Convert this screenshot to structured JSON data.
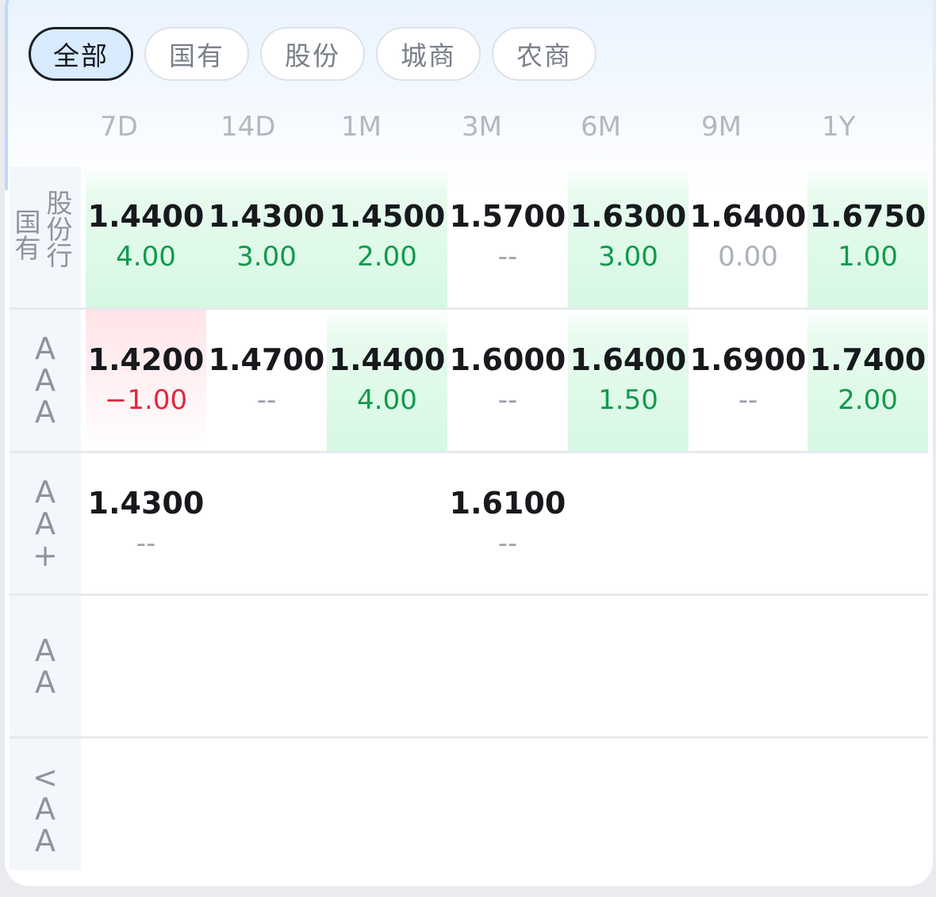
{
  "tabs": [
    {
      "label": "全部",
      "active": true
    },
    {
      "label": "国有",
      "active": false
    },
    {
      "label": "股份",
      "active": false
    },
    {
      "label": "城商",
      "active": false
    },
    {
      "label": "农商",
      "active": false
    }
  ],
  "columns": [
    "7D",
    "14D",
    "1M",
    "3M",
    "6M",
    "9M",
    "1Y"
  ],
  "rows": [
    {
      "label_left": "国有",
      "label_right": "股份行",
      "cells": [
        {
          "rate": "1.4400",
          "change": "4.00",
          "trend": "up"
        },
        {
          "rate": "1.4300",
          "change": "3.00",
          "trend": "up"
        },
        {
          "rate": "1.4500",
          "change": "2.00",
          "trend": "up"
        },
        {
          "rate": "1.5700",
          "change": "--",
          "trend": "none"
        },
        {
          "rate": "1.6300",
          "change": "3.00",
          "trend": "up"
        },
        {
          "rate": "1.6400",
          "change": "0.00",
          "trend": "zero"
        },
        {
          "rate": "1.6750",
          "change": "1.00",
          "trend": "up"
        }
      ]
    },
    {
      "label": "AAA",
      "cells": [
        {
          "rate": "1.4200",
          "change": "−1.00",
          "trend": "down"
        },
        {
          "rate": "1.4700",
          "change": "--",
          "trend": "none"
        },
        {
          "rate": "1.4400",
          "change": "4.00",
          "trend": "up"
        },
        {
          "rate": "1.6000",
          "change": "--",
          "trend": "none"
        },
        {
          "rate": "1.6400",
          "change": "1.50",
          "trend": "up"
        },
        {
          "rate": "1.6900",
          "change": "--",
          "trend": "none"
        },
        {
          "rate": "1.7400",
          "change": "2.00",
          "trend": "up"
        }
      ]
    },
    {
      "label": "AA+",
      "cells": [
        {
          "rate": "1.4300",
          "change": "--",
          "trend": "none"
        },
        {
          "rate": "",
          "change": "",
          "trend": "empty"
        },
        {
          "rate": "",
          "change": "",
          "trend": "empty"
        },
        {
          "rate": "1.6100",
          "change": "--",
          "trend": "none"
        },
        {
          "rate": "",
          "change": "",
          "trend": "empty"
        },
        {
          "rate": "",
          "change": "",
          "trend": "empty"
        },
        {
          "rate": "",
          "change": "",
          "trend": "empty"
        }
      ]
    },
    {
      "label": "AA",
      "cells": []
    },
    {
      "label": "<AA",
      "cells": []
    }
  ],
  "colors": {
    "up": "#119a4c",
    "down": "#e3273f",
    "neutral": "#9aa1ab",
    "active_tab_bg": "#d8ebff",
    "up_cell_bg": "#d6f8e3",
    "down_cell_bg": "#ffe4e8"
  }
}
